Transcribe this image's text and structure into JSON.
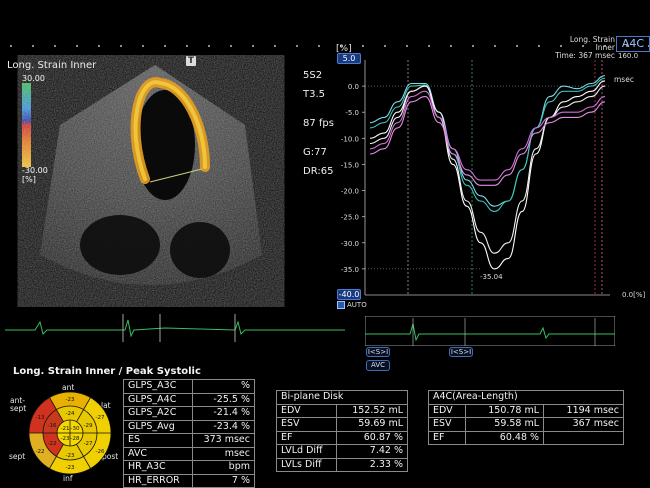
{
  "left_panel": {
    "title": "Long. Strain Inner",
    "scale_top": "30.00",
    "scale_bottom": "-30.00",
    "scale_unit": "[%]",
    "t_marker": "T",
    "params": [
      "5S2",
      "T3.5",
      "87 fps",
      "G:77",
      "DR:65"
    ]
  },
  "graph": {
    "title": "Long. Strain Inner",
    "time": "Time: 367 msec",
    "view": "A4C",
    "unit_label": "[%]",
    "max_box": "5.0",
    "min_box": "-40.0",
    "right_top_value": "160.0",
    "msec_label": "msec",
    "right_bottom_value": "0.0[%]",
    "auto_label": "AUTO",
    "peak_label": "-35.04",
    "y_ticks": [
      "0.0",
      "-5.0",
      "-10.0",
      "-15.0",
      "-20.0",
      "-25.0",
      "-30.0",
      "-35.0"
    ],
    "ylim": [
      -40,
      5
    ],
    "curves": [
      {
        "color": "#7fd8e6",
        "values": [
          -7,
          -6,
          -3,
          0.5,
          0.5,
          -5,
          -12,
          -18,
          -21,
          -23,
          -22,
          -16,
          -8,
          -2,
          0,
          -0.5,
          0.5,
          2
        ]
      },
      {
        "color": "#3ec0b8",
        "values": [
          -8,
          -7,
          -4,
          0,
          0.2,
          -6,
          -13,
          -19,
          -22,
          -24,
          -22,
          -16,
          -8,
          -3,
          -1,
          -1,
          0,
          1.5
        ]
      },
      {
        "color": "#ffffff",
        "values": [
          -10,
          -9,
          -5,
          -1,
          0,
          -6,
          -15,
          -23,
          -30,
          -35,
          -33,
          -24,
          -13,
          -6,
          -3,
          -2,
          -1,
          1
        ]
      },
      {
        "color": "#f0f0f0",
        "values": [
          -11,
          -10,
          -6,
          -1,
          0,
          -5,
          -14,
          -22,
          -28,
          -32,
          -30,
          -22,
          -12,
          -6,
          -4,
          -3,
          -2,
          0
        ]
      },
      {
        "color": "#d070d8",
        "values": [
          -12,
          -11,
          -7,
          -2,
          -1,
          -6,
          -12,
          -16,
          -18,
          -18,
          -16,
          -12,
          -8,
          -6,
          -5,
          -5,
          -4,
          -2
        ]
      },
      {
        "color": "#e090e0",
        "values": [
          -13,
          -12,
          -8,
          -3,
          -2,
          -7,
          -13,
          -17,
          -19,
          -19,
          -17,
          -13,
          -9,
          -7,
          -6,
          -6,
          -5,
          -3
        ]
      }
    ]
  },
  "ecg": {
    "btn1": "I<S>I",
    "btn2": "I<S>I",
    "avc": "AVC"
  },
  "bullseye": {
    "title": "Long. Strain Inner / Peak Systolic",
    "labels": {
      "ant": "ant",
      "ant_sept": "ant-\nsept",
      "lat": "lat",
      "sept": "sept",
      "post": "post",
      "inf": "inf"
    }
  },
  "glps_table": [
    [
      "GLPS_A3C",
      "%"
    ],
    [
      "GLPS_A4C",
      "-25.5 %"
    ],
    [
      "GLPS_A2C",
      "-21.4 %"
    ],
    [
      "GLPS_Avg",
      "-23.4 %"
    ],
    [
      "ES",
      "373 msec"
    ],
    [
      "AVC",
      "msec"
    ],
    [
      "HR_A3C",
      "bpm"
    ],
    [
      "HR_ERROR",
      "7 %"
    ]
  ],
  "biplane_table": {
    "header": "Bi-plane Disk",
    "rows": [
      [
        "EDV",
        "152.52 mL"
      ],
      [
        "ESV",
        "59.69 mL"
      ],
      [
        "EF",
        "60.87 %"
      ],
      [
        "LVLd Diff",
        "7.42 %"
      ],
      [
        "LVLs Diff",
        "2.33 %"
      ]
    ]
  },
  "a4c_table": {
    "header": "A4C(Area-Length)",
    "rows": [
      [
        "EDV",
        "150.78 mL",
        "1194 msec"
      ],
      [
        "ESV",
        "59.58 mL",
        "367 msec"
      ],
      [
        "EF",
        "60.48 %",
        ""
      ]
    ]
  }
}
